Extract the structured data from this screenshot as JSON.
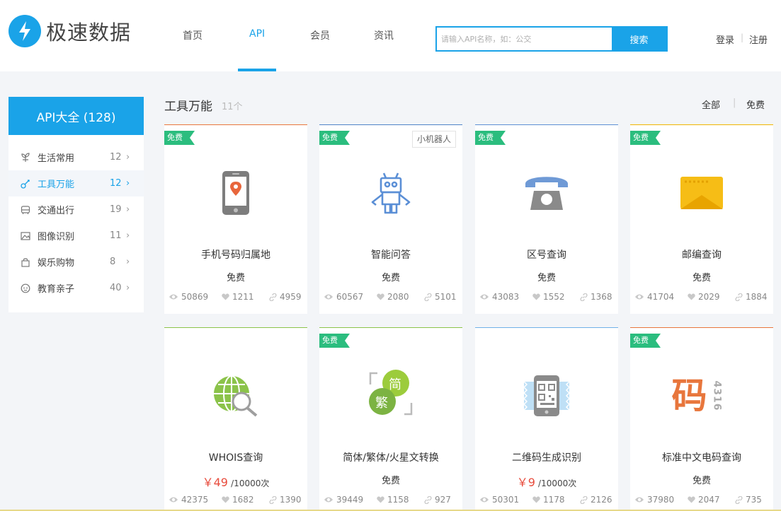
{
  "header": {
    "logo_text": "极速数据",
    "nav": [
      {
        "label": "首页"
      },
      {
        "label": "API"
      },
      {
        "label": "会员"
      },
      {
        "label": "资讯"
      }
    ],
    "active_nav": "API",
    "search": {
      "placeholder": "请输入API名称，如：公交",
      "button": "搜索"
    },
    "login": "登录",
    "register": "注册",
    "auth_separator": "|"
  },
  "sidebar": {
    "title": "API大全 (128)",
    "items": [
      {
        "label": "生活常用",
        "count": "12",
        "icon": "plant-icon"
      },
      {
        "label": "工具万能",
        "count": "12",
        "icon": "tools-icon",
        "active": true
      },
      {
        "label": "交通出行",
        "count": "19",
        "icon": "bus-icon"
      },
      {
        "label": "图像识别",
        "count": "11",
        "icon": "image-icon"
      },
      {
        "label": "娱乐购物",
        "count": "8",
        "icon": "bag-icon"
      },
      {
        "label": "教育亲子",
        "count": "40",
        "icon": "baby-icon"
      }
    ]
  },
  "main": {
    "title": "工具万能",
    "count": "11个",
    "filter_all": "全部",
    "filter_free": "免费",
    "filter_separator": "|"
  },
  "cards": [
    {
      "name": "手机号码归属地",
      "price": "免费",
      "badge": "免费",
      "views": "50869",
      "likes": "1211",
      "links": "4959",
      "icon": "phone-location-icon",
      "accent": "#e8763c"
    },
    {
      "name": "智能问答",
      "price": "免费",
      "badge": "免费",
      "tag": "小机器人",
      "views": "60567",
      "likes": "2080",
      "links": "5101",
      "icon": "robot-icon",
      "accent": "#4f83c7"
    },
    {
      "name": "区号查询",
      "price": "免费",
      "badge": "免费",
      "views": "43083",
      "likes": "1552",
      "links": "1368",
      "icon": "telephone-icon",
      "accent": "#5d8fd4"
    },
    {
      "name": "邮编查询",
      "price": "免费",
      "badge": "免费",
      "views": "41704",
      "likes": "2029",
      "links": "1884",
      "icon": "envelope-icon",
      "accent": "#f0b400"
    },
    {
      "name": "WHOIS查询",
      "price_amount": "￥49",
      "price_unit": "/10000次",
      "views": "42375",
      "likes": "1682",
      "links": "1390",
      "icon": "globe-search-icon",
      "accent": "#8bc34a"
    },
    {
      "name": "简体/繁体/火星文转换",
      "price": "免费",
      "badge": "免费",
      "icon_text_1": "简",
      "icon_text_2": "繁",
      "views": "39449",
      "likes": "1158",
      "links": "927",
      "icon": "simplified-traditional-icon",
      "accent": "#8bc34a"
    },
    {
      "name": "二维码生成识别",
      "price_amount": "￥9",
      "price_unit": "/10000次",
      "views": "50301",
      "likes": "1178",
      "links": "2126",
      "icon": "qrcode-phone-icon",
      "accent": "#6fb0e8"
    },
    {
      "name": "标准中文电码查询",
      "price": "免费",
      "badge": "免费",
      "icon_text_1": "码",
      "icon_text_2": "4316",
      "views": "37980",
      "likes": "2047",
      "links": "735",
      "icon": "chinese-code-icon",
      "accent": "#e8763c"
    }
  ]
}
